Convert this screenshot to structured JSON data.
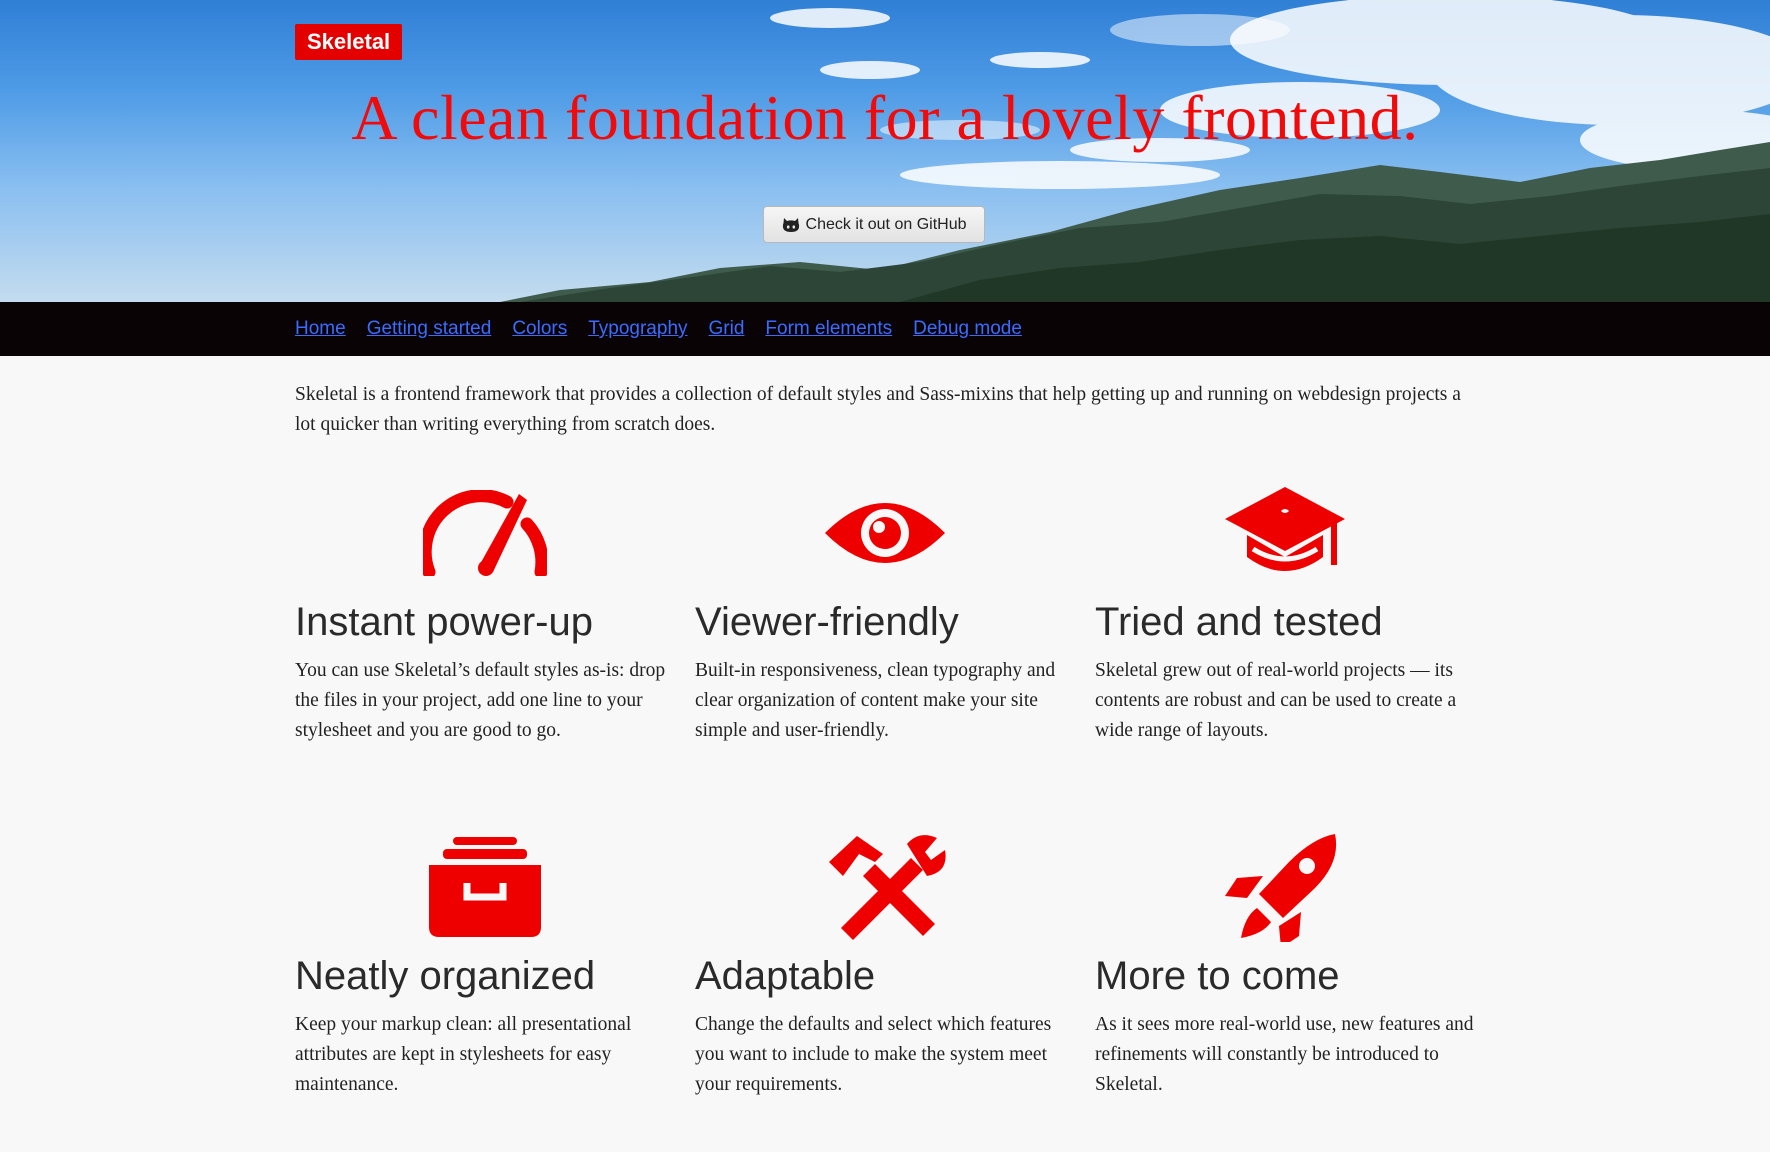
{
  "colors": {
    "accent": "#e50000",
    "nav_background": "#0a0306",
    "link": "#3b6bff",
    "page_background": "#f8f8f8"
  },
  "hero": {
    "brand": "Skeletal",
    "title": "A clean foundation for a lovely frontend.",
    "github_button": {
      "icon": "octocat-icon",
      "label": "Check it out on GitHub"
    }
  },
  "nav": {
    "items": [
      {
        "label": "Home"
      },
      {
        "label": "Getting started"
      },
      {
        "label": "Colors"
      },
      {
        "label": "Typography"
      },
      {
        "label": "Grid"
      },
      {
        "label": "Form elements"
      },
      {
        "label": "Debug mode"
      }
    ]
  },
  "intro": "Skeletal is a frontend framework that provides a collection of default styles and Sass-mixins that help getting up and running on webdesign projects a lot quicker than writing everything from scratch does.",
  "features": [
    {
      "icon": "dashboard-gauge-icon",
      "title": "Instant power-up",
      "text": "You can use Skeletal’s default styles as-is: drop the files in your project, add one line to your stylesheet and you are good to go."
    },
    {
      "icon": "eye-icon",
      "title": "Viewer-friendly",
      "text": "Built-in responsiveness, clean typography and clear organization of content make your site simple and user-friendly."
    },
    {
      "icon": "graduation-cap-icon",
      "title": "Tried and tested",
      "text": "Skeletal grew out of real-world projects — its contents are robust and can be used to create a wide range of layouts."
    },
    {
      "icon": "archive-box-icon",
      "title": "Neatly organized",
      "text": "Keep your markup clean: all presentational attributes are kept in stylesheets for easy maintenance."
    },
    {
      "icon": "hammer-wrench-icon",
      "title": "Adaptable",
      "text": "Change the defaults and select which features you want to include to make the system meet your requirements."
    },
    {
      "icon": "rocket-icon",
      "title": "More to come",
      "text": "As it sees more real-world use, new features and refinements will constantly be introduced to Skeletal."
    }
  ]
}
